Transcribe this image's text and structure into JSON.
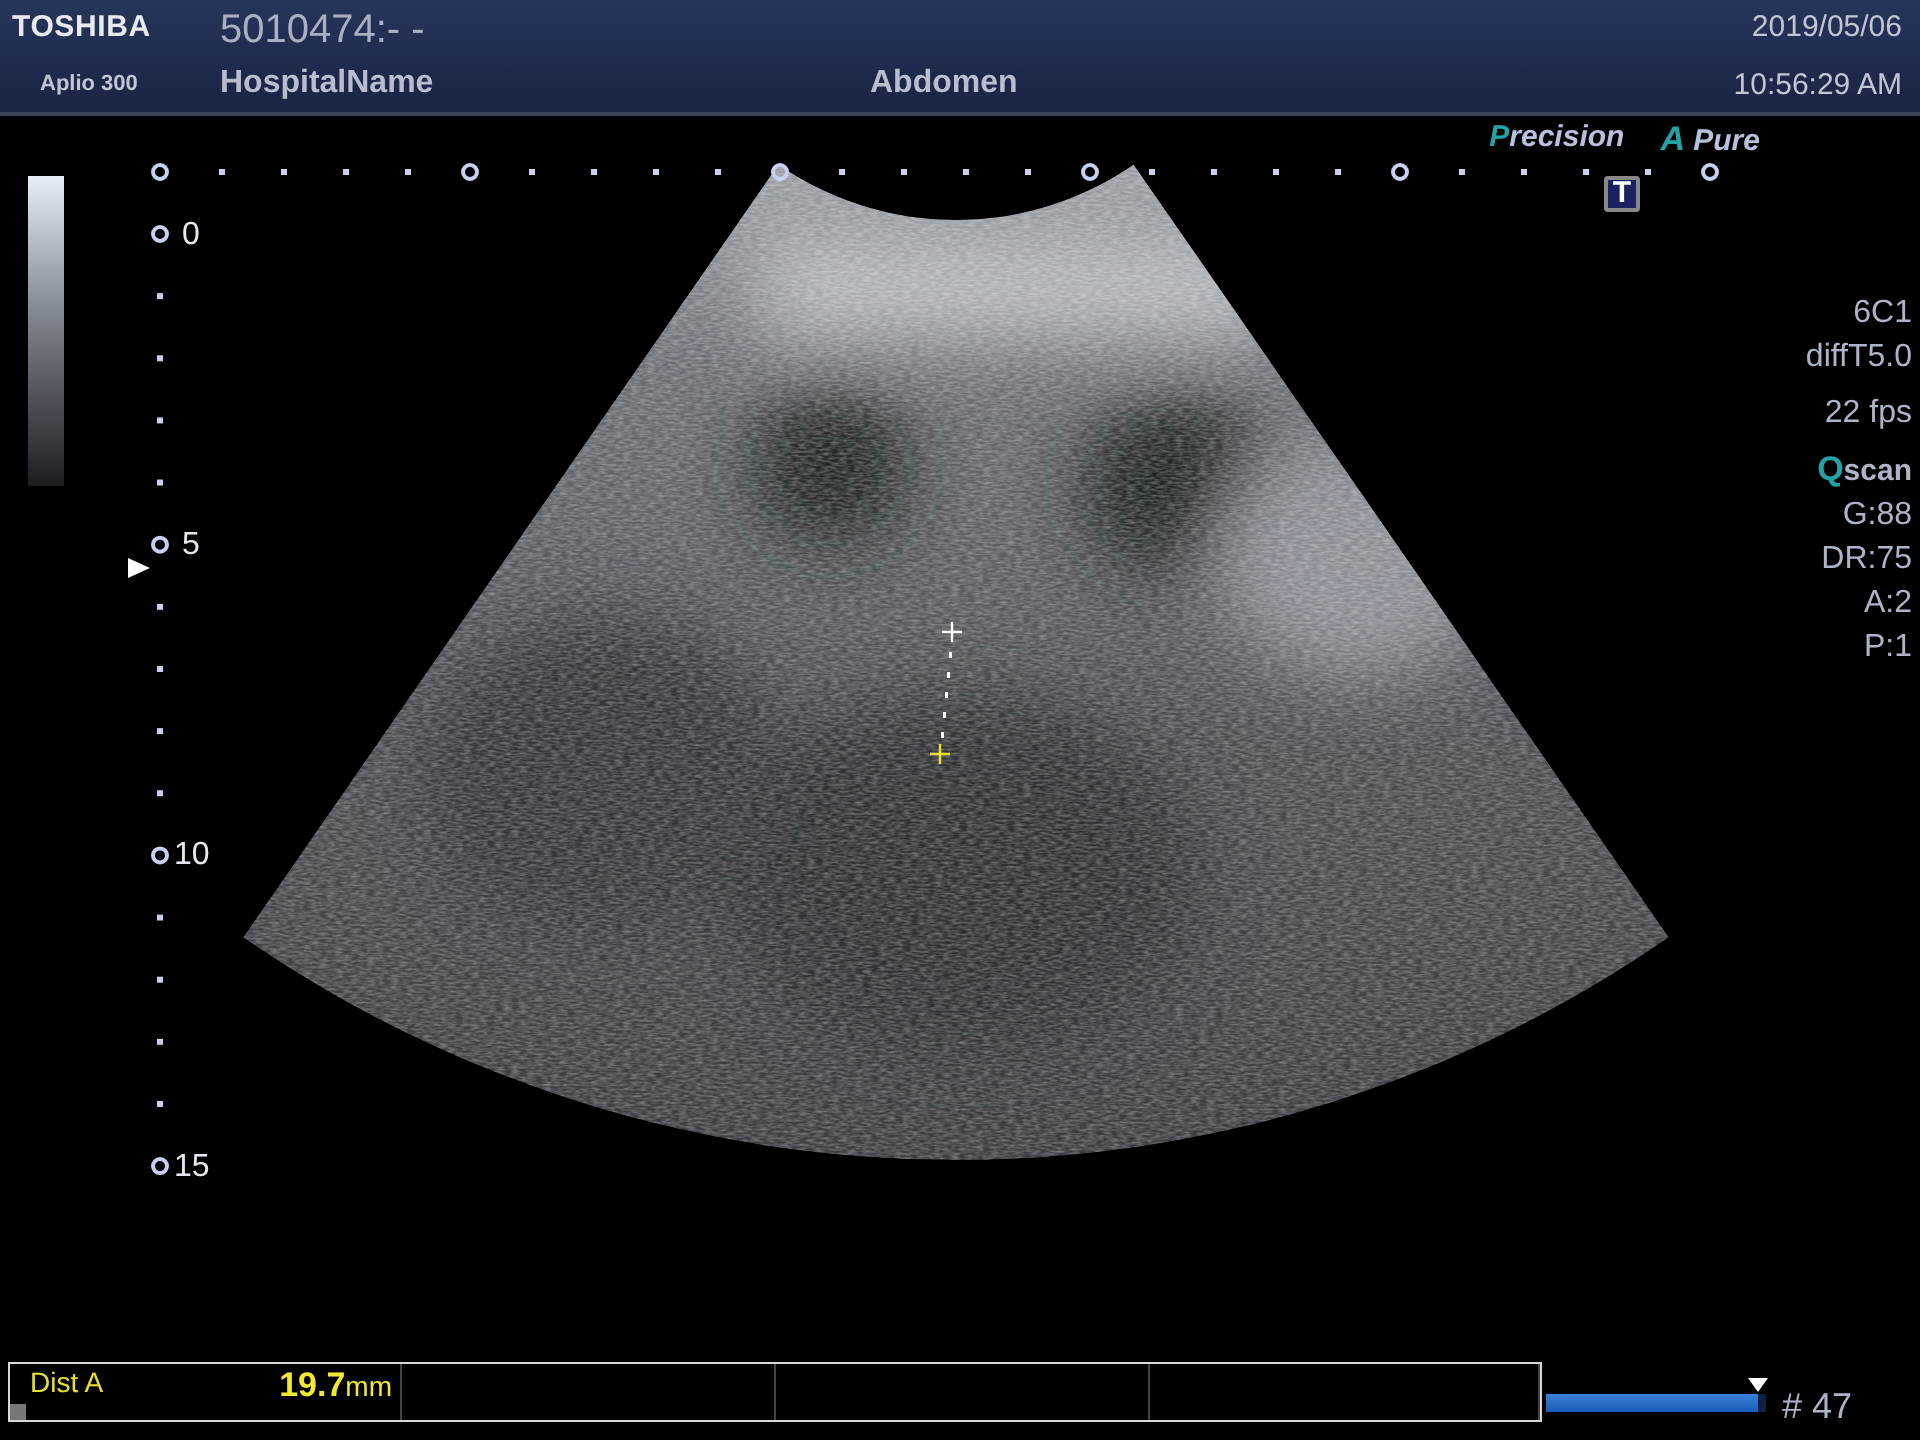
{
  "header": {
    "brand": "TOSHIBA",
    "model": "Aplio 300",
    "patient_id": "5010474:- -",
    "hospital": "HospitalName",
    "exam": "Abdomen",
    "date": "2019/05/06",
    "time": "10:56:29 AM"
  },
  "image_tags": [
    {
      "accent": "P",
      "text": "recision"
    },
    {
      "accent": "A",
      "text": "Pure"
    }
  ],
  "body_mark": "T",
  "depth_scale": [
    "0",
    "5",
    "10",
    "15"
  ],
  "params": [
    {
      "kind": "text",
      "text": "6C1"
    },
    {
      "kind": "text",
      "text": "diffT5.0"
    },
    {
      "kind": "gap",
      "text": "22 fps"
    },
    {
      "kind": "accent",
      "accent": "Q",
      "text": "scan"
    },
    {
      "kind": "text",
      "text": "G:88"
    },
    {
      "kind": "text",
      "text": "DR:75"
    },
    {
      "kind": "text",
      "text": "A:2"
    },
    {
      "kind": "text",
      "text": "P:1"
    }
  ],
  "measurements": [
    {
      "label": "Dist A",
      "value": "19.7",
      "unit": "mm"
    }
  ],
  "cine": {
    "level": 0.96,
    "frame": "# 47"
  }
}
